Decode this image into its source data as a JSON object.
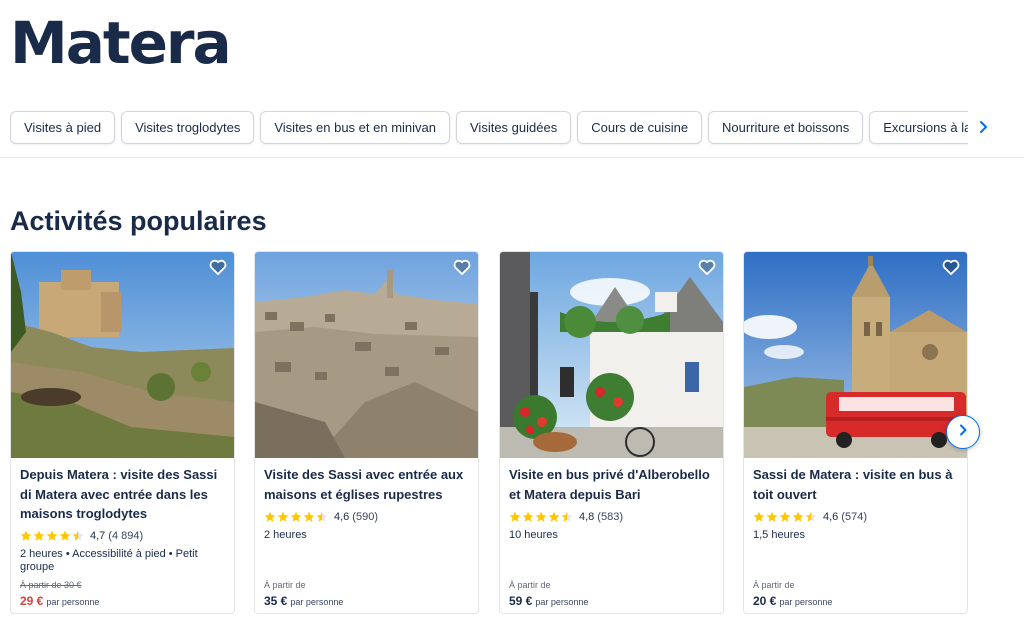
{
  "page": {
    "title": "Matera"
  },
  "categories": {
    "chips": [
      {
        "label": "Visites à pied"
      },
      {
        "label": "Visites troglodytes"
      },
      {
        "label": "Visites en bus et en minivan"
      },
      {
        "label": "Visites guidées"
      },
      {
        "label": "Cours de cuisine"
      },
      {
        "label": "Nourriture et boissons"
      },
      {
        "label": "Excursions à la journée"
      }
    ],
    "next_icon": "chevron-right-icon"
  },
  "section": {
    "title": "Activités populaires"
  },
  "colors": {
    "brand_navy": "#1a2b49",
    "accent_blue": "#0071eb",
    "star_yellow": "#ffc700",
    "sale_red": "#d4423b"
  },
  "cards": [
    {
      "title": "Depuis Matera : visite des Sassi di Matera avec entrée dans les maisons troglodytes",
      "stars": 4.5,
      "rating": "4,7",
      "reviews": "(4 894)",
      "details": "2 heures • Accessibilité à pied • Petit groupe",
      "from_label": "À partir de 30 €",
      "price": "29 €",
      "per": "par personne",
      "image_icon": "sassi-cliff-photo"
    },
    {
      "title": "Visite des Sassi avec entrée aux maisons et églises rupestres",
      "stars": 4.5,
      "rating": "4,6",
      "reviews": "(590)",
      "details": "2 heures",
      "from_label": "À partir de",
      "price": "35 €",
      "per": "par personne",
      "image_icon": "sassi-town-photo"
    },
    {
      "title": "Visite en bus privé d'Alberobello et Matera depuis Bari",
      "stars": 4.5,
      "rating": "4,8",
      "reviews": "(583)",
      "details": "10 heures",
      "from_label": "À partir de",
      "price": "59 €",
      "per": "par personne",
      "image_icon": "trulli-street-photo"
    },
    {
      "title": "Sassi de Matera : visite en bus à toit ouvert",
      "stars": 4.5,
      "rating": "4,6",
      "reviews": "(574)",
      "details": "1,5 heures",
      "from_label": "À partir de",
      "price": "20 €",
      "per": "par personne",
      "image_icon": "red-bus-cathedral-photo"
    }
  ],
  "carousel": {
    "next_icon": "chevron-right-icon",
    "wishlist_icon": "heart-icon",
    "star_icon": "star-icon"
  }
}
